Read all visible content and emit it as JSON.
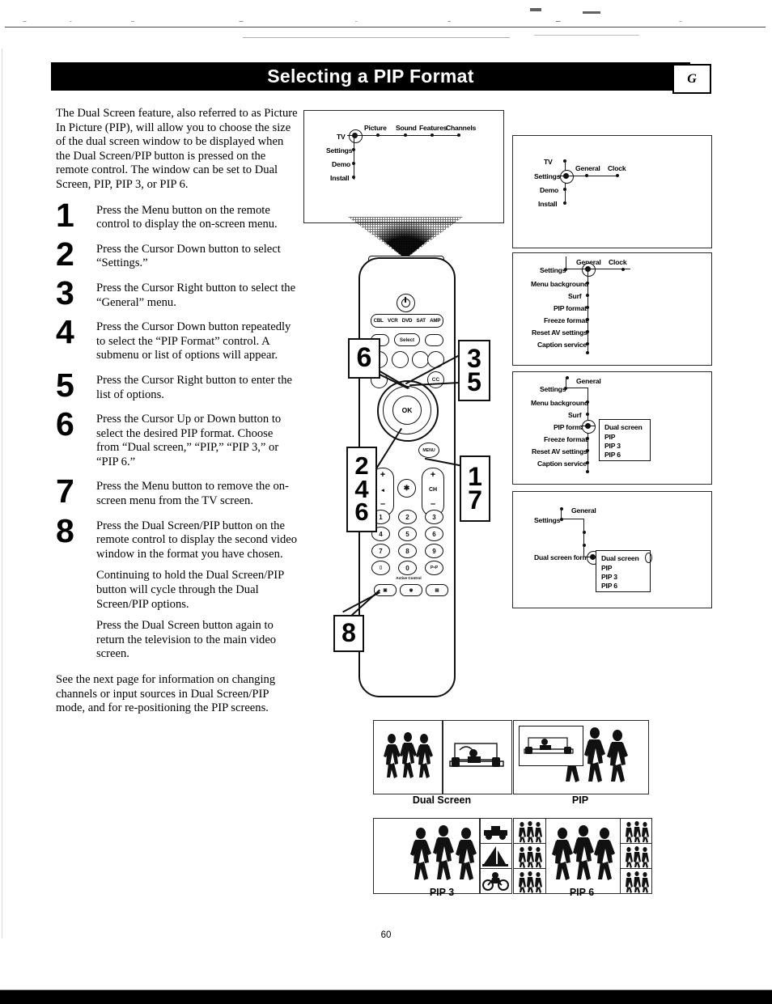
{
  "header": {
    "title": "Selecting a PIP Format",
    "tab_letter": "G"
  },
  "intro": "The Dual Screen feature, also referred to as Picture In Picture (PIP), will allow you to choose the size of the dual screen window to be displayed when the Dual Screen/PIP button is pressed on the remote control. The window can be set to Dual Screen, PIP, PIP 3, or PIP 6.",
  "steps": [
    {
      "num": "1",
      "paras": [
        "Press the Menu button on the remote control to display the on-screen menu."
      ]
    },
    {
      "num": "2",
      "paras": [
        "Press the Cursor Down button to select “Settings.”"
      ]
    },
    {
      "num": "3",
      "paras": [
        "Press the Cursor Right button to select the “General” menu."
      ]
    },
    {
      "num": "4",
      "paras": [
        "Press the Cursor Down button repeatedly to select the “PIP Format” control. A submenu or list of options will appear."
      ]
    },
    {
      "num": "5",
      "paras": [
        "Press the Cursor Right button to enter the list of options."
      ]
    },
    {
      "num": "6",
      "paras": [
        "Press the Cursor Up or Down button to select the desired PIP format. Choose from “Dual screen,” “PIP,” “PIP 3,” or “PIP 6.”"
      ]
    },
    {
      "num": "7",
      "paras": [
        "Press the Menu button to remove the on-screen menu from the TV screen."
      ]
    },
    {
      "num": "8",
      "paras": [
        "Press the Dual Screen/PIP button on the remote control to display the second video window in the format you have chosen.",
        "Continuing to hold the Dual Screen/PIP button will cycle through the Dual Screen/PIP options.",
        "Press the Dual Screen button again to return the television to the main video screen."
      ]
    }
  ],
  "closing": "See the next page for information on changing channels or input sources in Dual Screen/PIP mode, and for re-positioning the PIP screens.",
  "menu_screens": [
    {
      "id": "screen-main-menu",
      "vertical_items": [
        "TV",
        "Settings",
        "Demo",
        "Install"
      ],
      "horizontal_items": [
        "Picture",
        "Sound",
        "Features",
        "Channels"
      ],
      "cursor_on": "TV"
    },
    {
      "id": "screen-settings",
      "vertical_items": [
        "TV",
        "Settings",
        "Demo",
        "Install"
      ],
      "horizontal_items": [
        "General",
        "Clock"
      ],
      "cursor_on": "Settings"
    },
    {
      "id": "screen-general",
      "vertical_items": [
        "Settings",
        "Menu background",
        "Surf",
        "PIP format",
        "Freeze format",
        "Reset AV settings",
        "Caption service"
      ],
      "horizontal_items": [
        "General",
        "Clock"
      ],
      "cursor_on": "General"
    },
    {
      "id": "screen-pip-format",
      "vertical_items": [
        "Settings",
        "Menu background",
        "Surf",
        "PIP format",
        "Freeze format",
        "Reset AV settings",
        "Caption service"
      ],
      "horizontal_items": [
        "General"
      ],
      "cursor_on": "PIP format",
      "options": [
        "Dual screen",
        "PIP",
        "PIP 3",
        "PIP 6"
      ]
    },
    {
      "id": "screen-dual-screen-format",
      "vertical_items": [
        "Settings",
        "Dual screen format"
      ],
      "horizontal_items": [
        "General"
      ],
      "cursor_on": "Dual screen format",
      "options": [
        "Dual screen",
        "PIP",
        "PIP 3",
        "PIP 6"
      ],
      "selected_option": "Dual screen"
    }
  ],
  "remote": {
    "device_buttons": [
      "CBL",
      "VCR",
      "DVD",
      "SAT",
      "AMP"
    ],
    "select_label": "Select",
    "ok_label": "OK",
    "menu_label": "MENU",
    "cc_label": "CC",
    "vol_label": "VOL",
    "ch_label": "CH",
    "plus": "+",
    "minus": "–",
    "keypad": [
      "1",
      "2",
      "3",
      "4",
      "5",
      "6",
      "7",
      "8",
      "9",
      "0"
    ],
    "active_control_label": "Active Control",
    "callouts": [
      {
        "id": "callout-6-left",
        "numbers": [
          "6"
        ]
      },
      {
        "id": "callout-3-5-right",
        "numbers": [
          "3",
          "5"
        ]
      },
      {
        "id": "callout-2-4-6-left",
        "numbers": [
          "2",
          "4",
          "6"
        ]
      },
      {
        "id": "callout-1-7-right",
        "numbers": [
          "1",
          "7"
        ]
      },
      {
        "id": "callout-8-bottom",
        "numbers": [
          "8"
        ]
      }
    ]
  },
  "picture_examples": [
    {
      "id": "example-dual-screen",
      "caption": "Dual Screen"
    },
    {
      "id": "example-pip",
      "caption": "PIP"
    },
    {
      "id": "example-pip-3",
      "caption": "PIP 3"
    },
    {
      "id": "example-pip-6",
      "caption": "PIP 6"
    }
  ],
  "page_number": "60"
}
